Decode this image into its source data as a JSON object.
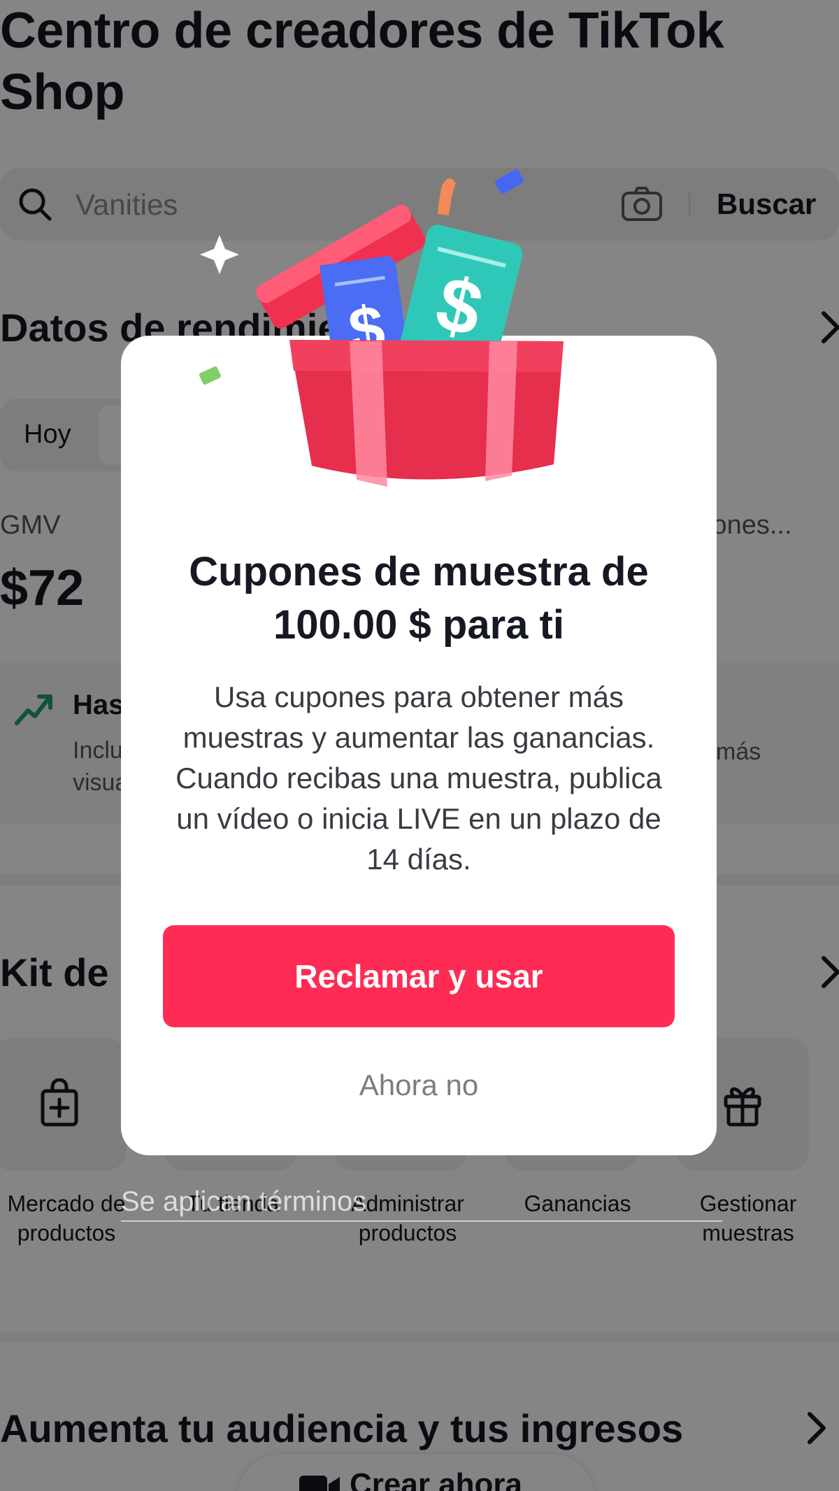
{
  "page": {
    "title": "Centro de creadores de TikTok Shop"
  },
  "search": {
    "placeholder": "Vanities",
    "button_label": "Buscar"
  },
  "performance": {
    "title": "Datos de rendimiento",
    "filter_today": "Hoy",
    "gmv_label": "GMV",
    "gmv_value": "$72",
    "right_metric_label": "iones..."
  },
  "tip": {
    "title": "Has",
    "text_line_1": "Inclu",
    "text_line_2": "visua",
    "text_right": "más"
  },
  "kit": {
    "title": "Kit de",
    "tools": [
      {
        "label": "Mercado de productos",
        "icon": "shopping-bag-plus-icon"
      },
      {
        "label": "Tu tienda",
        "icon": "store-icon"
      },
      {
        "label": "Administrar productos",
        "icon": "product-icon"
      },
      {
        "label": "Ganancias",
        "icon": "earnings-icon"
      },
      {
        "label": "Gestionar muestras",
        "icon": "gift-icon"
      }
    ]
  },
  "audience": {
    "title": "Aumenta tu audiencia y tus ingresos"
  },
  "create": {
    "label": "Crear ahora"
  },
  "modal": {
    "title": "Cupones de muestra de 100.00 $ para ti",
    "body": "Usa cupones para obtener más muestras y aumentar las ganancias. Cuando recibas una muestra, publica un vídeo o inicia LIVE en un plazo de 14 días.",
    "primary_button": "Reclamar y usar",
    "secondary_button": "Ahora no",
    "terms": "Se aplican términos"
  },
  "colors": {
    "primary": "#fe2c55",
    "gift_red": "#f0304f",
    "ticket_blue": "#4568f2",
    "ticket_teal": "#2fc8b8",
    "trend_green": "#20a06a"
  }
}
